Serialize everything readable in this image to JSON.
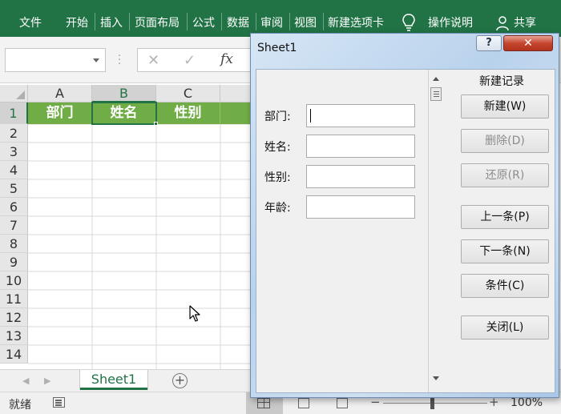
{
  "ribbon": {
    "tabs": [
      "文件",
      "开始",
      "插入",
      "页面布局",
      "公式",
      "数据",
      "审阅",
      "视图",
      "新建选项卡"
    ],
    "tell_me": "操作说明",
    "share": "共享"
  },
  "formula_bar": {
    "name_box": "",
    "cancel_icon": "✕",
    "enter_icon": "✓",
    "fx_label": "fx",
    "content": ""
  },
  "sheet": {
    "columns": [
      "A",
      "B",
      "C"
    ],
    "rows": [
      "1",
      "2",
      "3",
      "4",
      "5",
      "6",
      "7",
      "8",
      "9",
      "10",
      "11",
      "12",
      "13",
      "14"
    ],
    "header_cells": [
      "部门",
      "姓名",
      "性别"
    ],
    "selected_column": "B",
    "selected_row": "1",
    "header_fill_color": "#70ad47"
  },
  "sheet_tabs": {
    "prev_icon": "◀",
    "next_icon": "▶",
    "active": "Sheet1",
    "add_icon": "+"
  },
  "status_bar": {
    "status": "就绪",
    "zoom_minus": "−",
    "zoom_plus": "+",
    "zoom": "100%"
  },
  "dialog": {
    "title": "Sheet1",
    "help": "?",
    "close": "✕",
    "fields": [
      {
        "label": "部门:",
        "value": ""
      },
      {
        "label": "姓名:",
        "value": ""
      },
      {
        "label": "性别:",
        "value": ""
      },
      {
        "label": "年龄:",
        "value": ""
      }
    ],
    "record_label": "新建记录",
    "buttons": {
      "new": "新建(W)",
      "delete": "删除(D)",
      "restore": "还原(R)",
      "prev": "上一条(P)",
      "next": "下一条(N)",
      "criteria": "条件(C)",
      "close": "关闭(L)"
    }
  },
  "colors": {
    "ribbon": "#217346",
    "accent": "#217346"
  }
}
